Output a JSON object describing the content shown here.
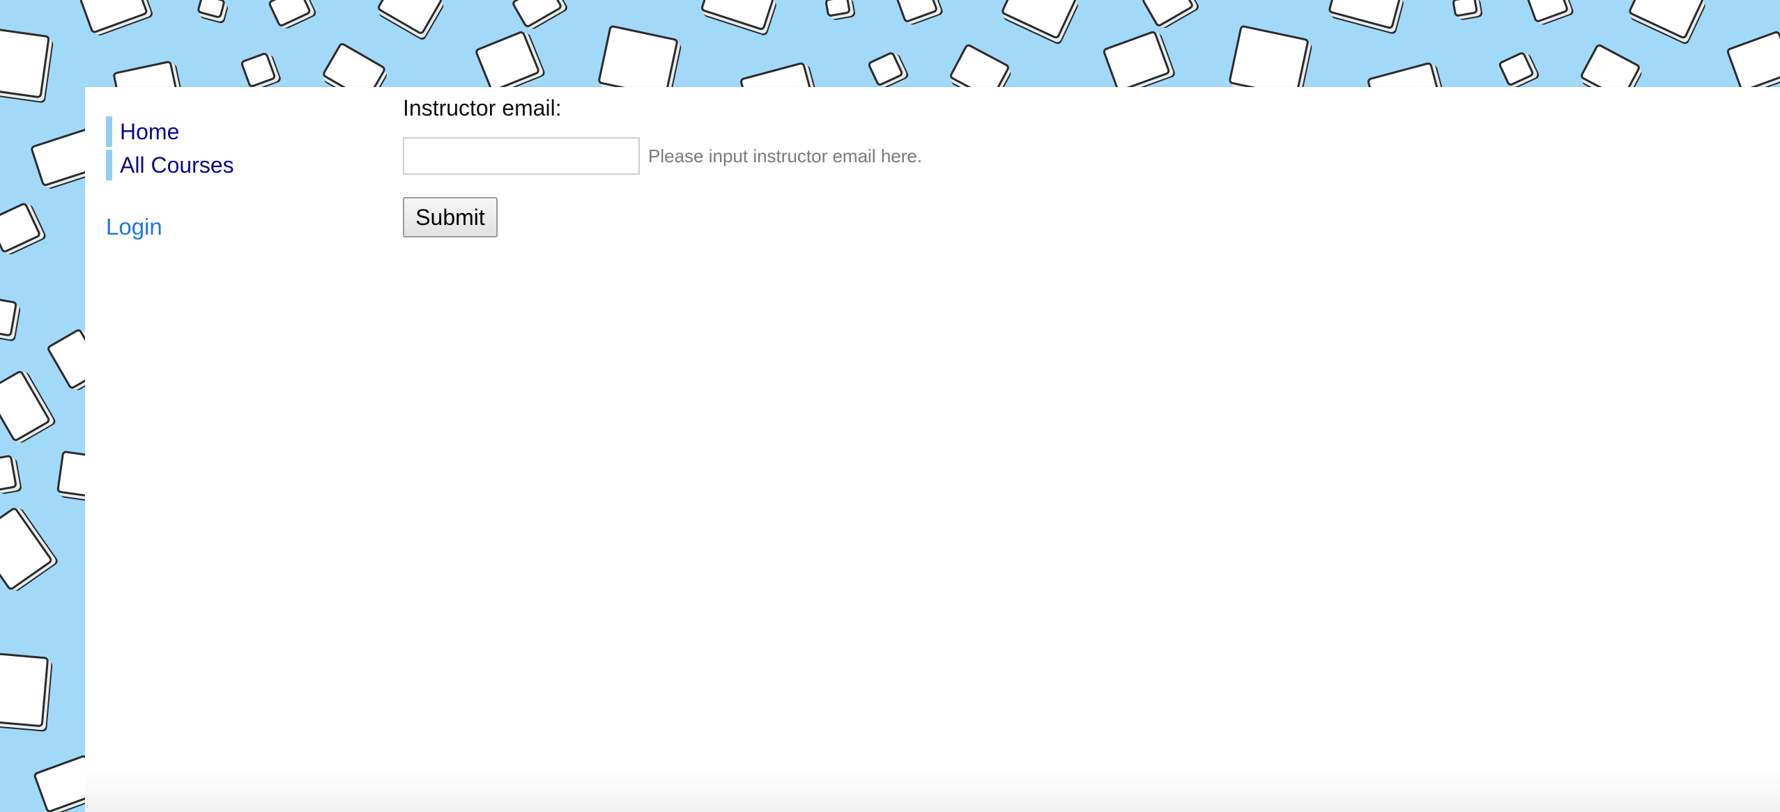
{
  "sidebar": {
    "items": [
      {
        "label": "Home"
      },
      {
        "label": "All Courses"
      }
    ],
    "login_label": "Login"
  },
  "form": {
    "instructor_email_label": "Instructor email:",
    "email_value": "",
    "email_hint": "Please input instructor email here.",
    "submit_label": "Submit"
  },
  "colors": {
    "background": "#a3d9f8",
    "nav_accent": "#8fd0f0",
    "nav_text": "#0a0a8a",
    "login_text": "#1f78e0"
  },
  "icons": {
    "background_pattern": "book-icon"
  }
}
